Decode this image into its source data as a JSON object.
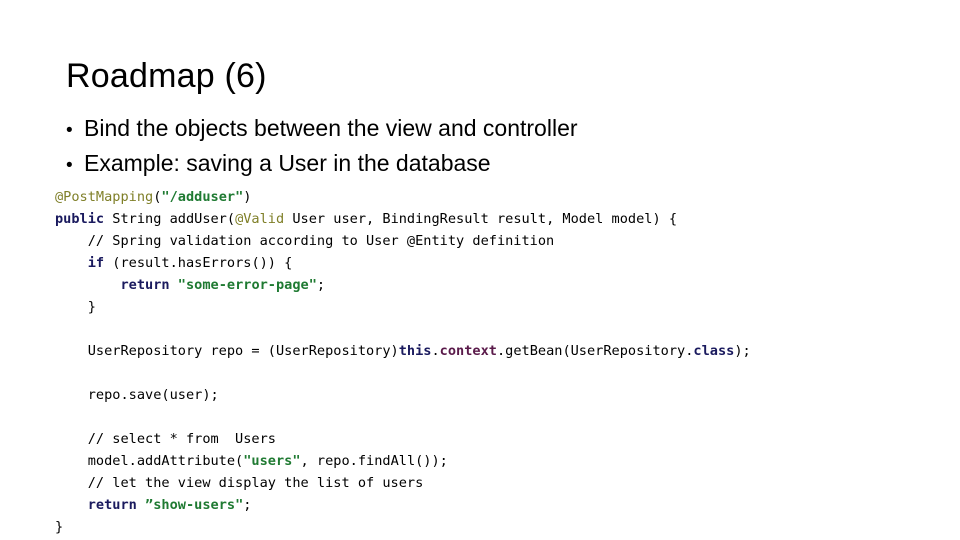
{
  "slide": {
    "title": "Roadmap (6)",
    "bullet_marker": "•",
    "bullets": [
      {
        "text": "Bind the objects between the view and controller"
      },
      {
        "text": "Example: saving a User in the database"
      }
    ]
  },
  "colors": {
    "background": "#ffffff",
    "text": "#000000",
    "annotation": "#7f7f28",
    "string": "#1f7a32",
    "keyword": "#1a1a5e",
    "member": "#5a1a4a",
    "comment": "#000000"
  },
  "code": {
    "language": "java",
    "plain_text": "@PostMapping(\"/adduser\")\npublic String addUser(@Valid User user, BindingResult result, Model model) {\n    // Spring validation according to User @Entity definition\n    if (result.hasErrors()) {\n        return \"some-error-page\";\n    }\n\n    UserRepository repo = (UserRepository)this.context.getBean(UserRepository.class);\n\n    repo.save(user);\n\n    // select * from  Users\n    model.addAttribute(\"users\", repo.findAll());\n    // let the view display the list of users\n    return ”show-users\";\n}",
    "lines": [
      {
        "id": "line-1",
        "tokens": [
          {
            "t": "@PostMapping",
            "c": "ann"
          },
          {
            "t": "(",
            "c": "plain"
          },
          {
            "t": "\"/adduser\"",
            "c": "str"
          },
          {
            "t": ")",
            "c": "plain"
          }
        ]
      },
      {
        "id": "line-2",
        "tokens": [
          {
            "t": "public",
            "c": "kw"
          },
          {
            "t": " String addUser(",
            "c": "plain"
          },
          {
            "t": "@Valid",
            "c": "ann"
          },
          {
            "t": " User user, BindingResult result, Model model) {",
            "c": "plain"
          }
        ]
      },
      {
        "id": "line-3",
        "tokens": [
          {
            "t": "    // Spring validation according to User @Entity definition",
            "c": "cmt"
          }
        ]
      },
      {
        "id": "line-4",
        "tokens": [
          {
            "t": "    ",
            "c": "plain"
          },
          {
            "t": "if",
            "c": "kw"
          },
          {
            "t": " (result.hasErrors()) {",
            "c": "plain"
          }
        ]
      },
      {
        "id": "line-5",
        "tokens": [
          {
            "t": "        ",
            "c": "plain"
          },
          {
            "t": "return",
            "c": "kw"
          },
          {
            "t": " ",
            "c": "plain"
          },
          {
            "t": "\"some-error-page\"",
            "c": "str"
          },
          {
            "t": ";",
            "c": "plain"
          }
        ]
      },
      {
        "id": "line-6",
        "tokens": [
          {
            "t": "    }",
            "c": "plain"
          }
        ]
      },
      {
        "id": "line-7",
        "tokens": [
          {
            "t": "",
            "c": "plain"
          }
        ]
      },
      {
        "id": "line-8",
        "tokens": [
          {
            "t": "    UserRepository repo = (UserRepository)",
            "c": "plain"
          },
          {
            "t": "this",
            "c": "kw"
          },
          {
            "t": ".",
            "c": "plain"
          },
          {
            "t": "context",
            "c": "mem"
          },
          {
            "t": ".getBean(UserRepository.",
            "c": "plain"
          },
          {
            "t": "class",
            "c": "kw"
          },
          {
            "t": ");",
            "c": "plain"
          }
        ]
      },
      {
        "id": "line-9",
        "tokens": [
          {
            "t": "",
            "c": "plain"
          }
        ]
      },
      {
        "id": "line-10",
        "tokens": [
          {
            "t": "    repo.save(user);",
            "c": "plain"
          }
        ]
      },
      {
        "id": "line-11",
        "tokens": [
          {
            "t": "",
            "c": "plain"
          }
        ]
      },
      {
        "id": "line-12",
        "tokens": [
          {
            "t": "    // select * from  Users",
            "c": "cmt"
          }
        ]
      },
      {
        "id": "line-13",
        "tokens": [
          {
            "t": "    model.addAttribute(",
            "c": "plain"
          },
          {
            "t": "\"users\"",
            "c": "str"
          },
          {
            "t": ", repo.findAll());",
            "c": "plain"
          }
        ]
      },
      {
        "id": "line-14",
        "tokens": [
          {
            "t": "    // let the view display the list of users",
            "c": "cmt"
          }
        ]
      },
      {
        "id": "line-15",
        "tokens": [
          {
            "t": "    ",
            "c": "plain"
          },
          {
            "t": "return",
            "c": "kw"
          },
          {
            "t": " ",
            "c": "plain"
          },
          {
            "t": "”show-users\"",
            "c": "str"
          },
          {
            "t": ";",
            "c": "plain"
          }
        ]
      },
      {
        "id": "line-16",
        "tokens": [
          {
            "t": "}",
            "c": "plain"
          }
        ]
      }
    ]
  }
}
